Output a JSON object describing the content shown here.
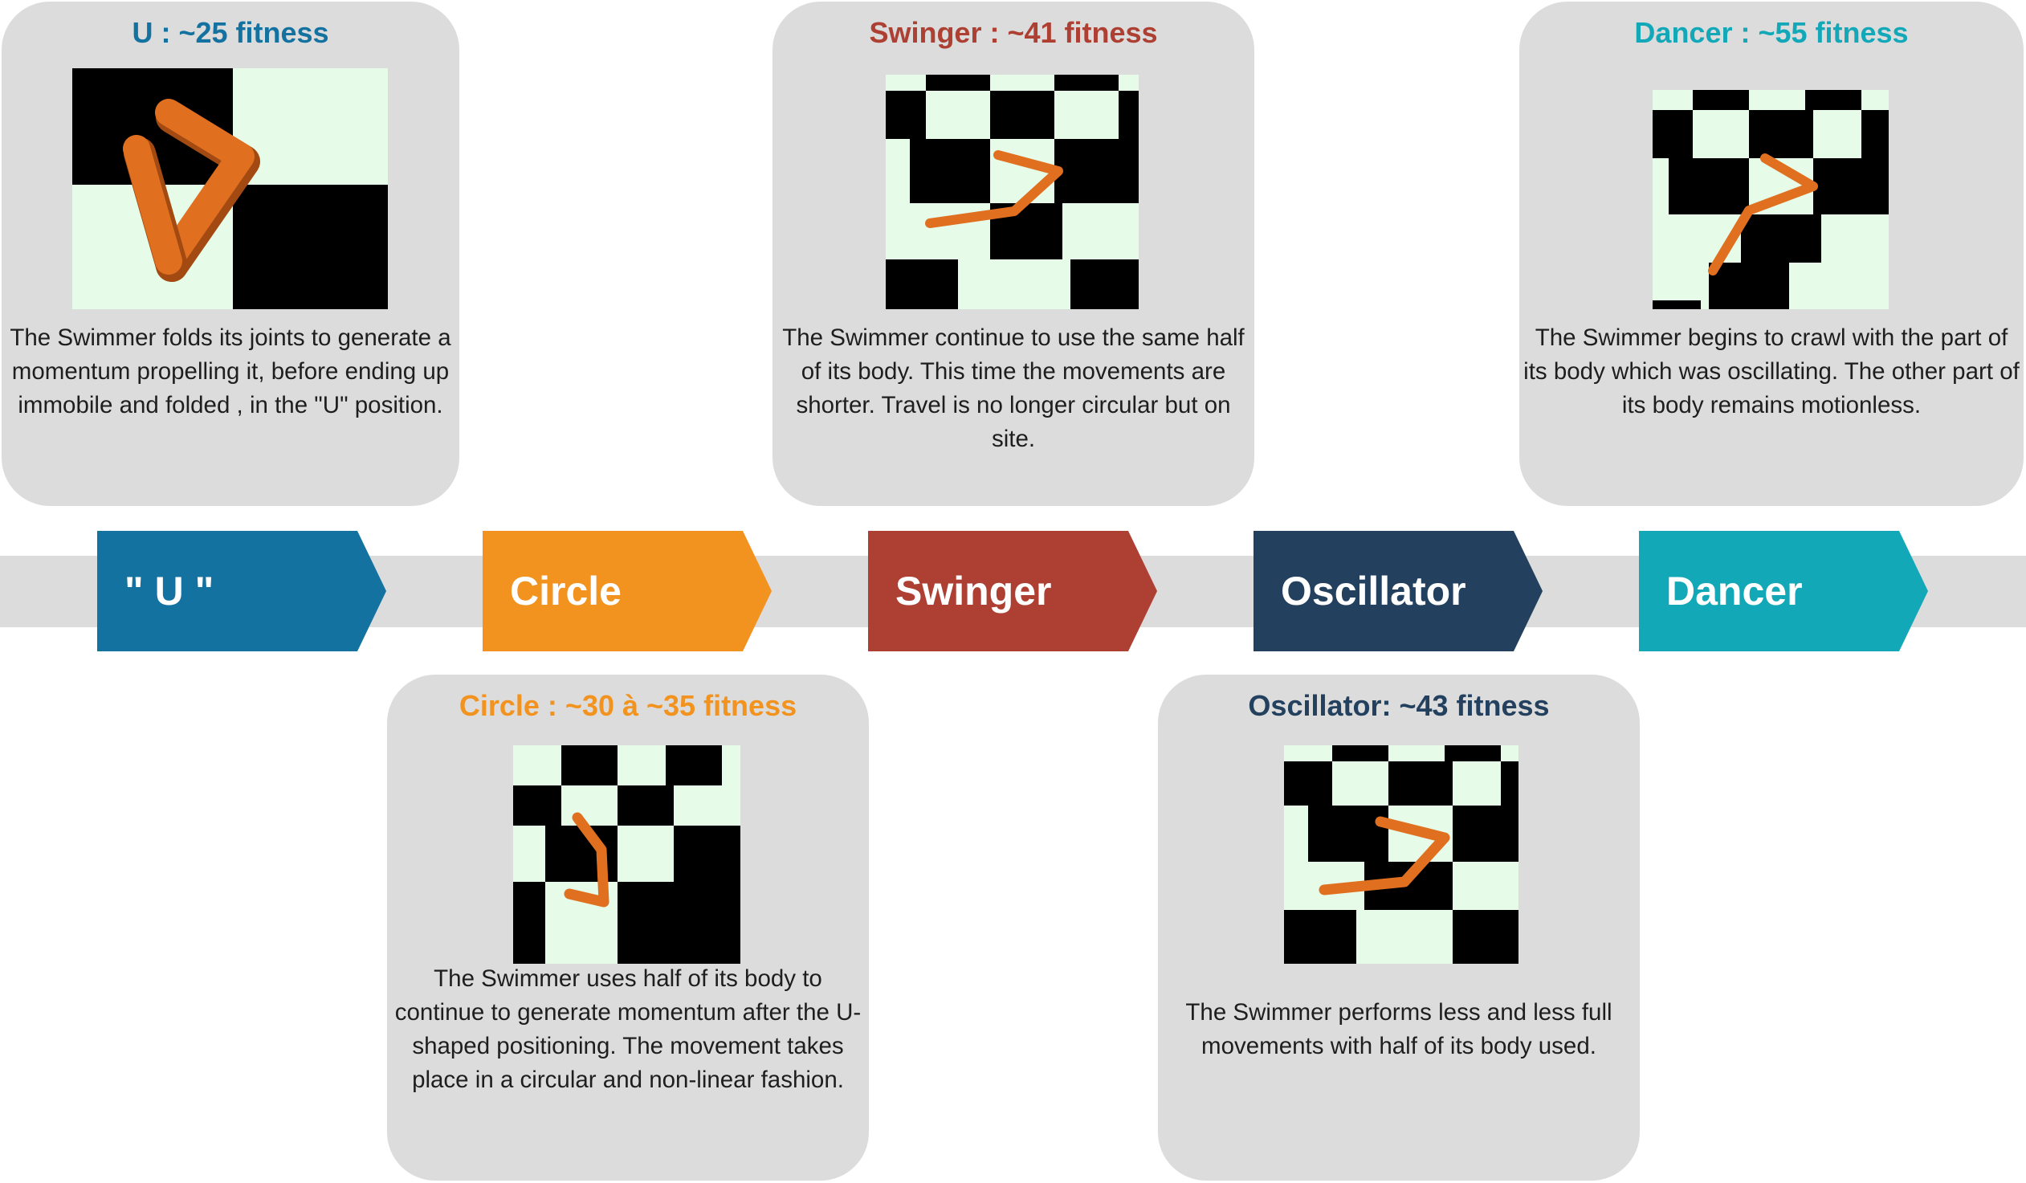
{
  "colors": {
    "u": "#1372a0",
    "circle": "#f29320",
    "swinger": "#ad4033",
    "oscillator": "#23415e",
    "dancer": "#13a8b8",
    "band": "#dcdcdc",
    "card": "#dcdcdc",
    "board_light": "#e6fbe8",
    "board_dark": "#000000",
    "swimmer": "#e07020"
  },
  "stages": [
    {
      "label": "\" U \""
    },
    {
      "label": "Circle"
    },
    {
      "label": "Swinger"
    },
    {
      "label": "Oscillator"
    },
    {
      "label": "Dancer"
    }
  ],
  "cards": {
    "u": {
      "title": "U : ~25 fitness",
      "description": "The Swimmer folds its joints to generate a momentum propelling it, before ending up immobile  and folded , in the \"U\" position.",
      "image": "swimmer-u-shape-image"
    },
    "circle": {
      "title": "Circle : ~30 à ~35 fitness",
      "description": "The Swimmer uses half of its body to continue to generate momentum after the U-shaped positioning. The movement takes place in a circular and non-linear fashion.",
      "image": "swimmer-circle-image"
    },
    "swinger": {
      "title": "Swinger : ~41 fitness",
      "description": "The Swimmer continue to use the same half of its body. This time the movements are shorter. Travel is no longer circular but on site.",
      "image": "swimmer-swinger-image"
    },
    "oscillator": {
      "title": "Oscillator: ~43 fitness",
      "description": "The Swimmer performs less and less full movements with half of its body used.",
      "image": "swimmer-oscillator-image"
    },
    "dancer": {
      "title": "Dancer : ~55 fitness",
      "description": "The Swimmer begins to crawl with the part of its body which was oscillating. The other part of its body remains motionless.",
      "image": "swimmer-dancer-image"
    }
  }
}
